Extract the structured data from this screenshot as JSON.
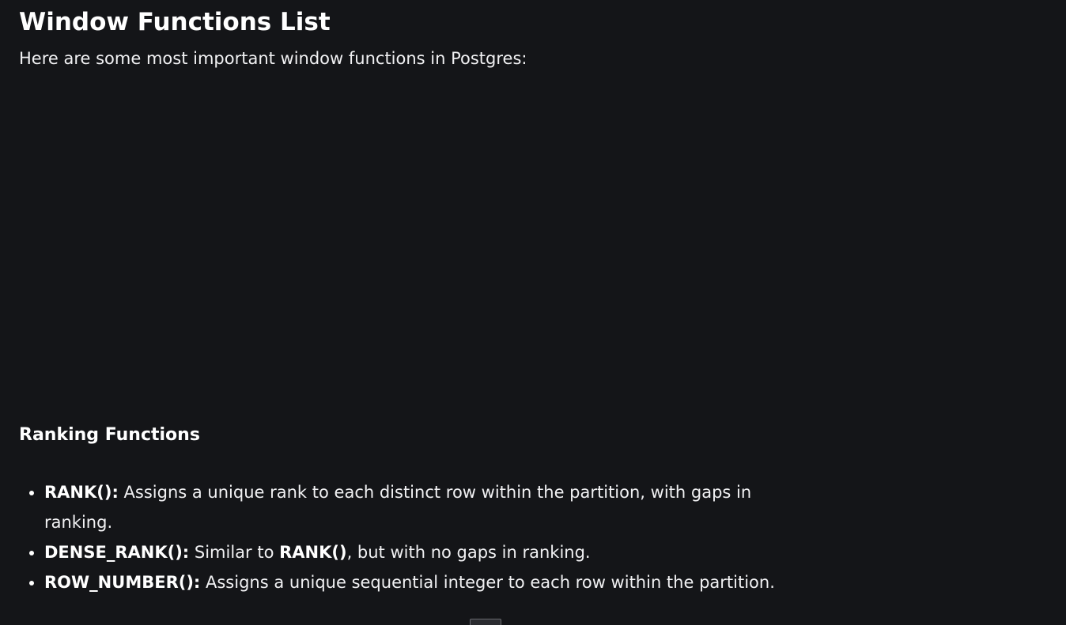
{
  "section": {
    "title": "Window Functions List",
    "intro": "Here are some most important window functions in Postgres:"
  },
  "ranking": {
    "heading": "Ranking Functions",
    "items": [
      {
        "name": "RANK():",
        "desc": " Assigns a unique rank to each distinct row within the partition, with gaps in ranking."
      },
      {
        "name": "DENSE_RANK():",
        "desc_before": " Similar to ",
        "ref": "RANK()",
        "desc_after": ", but with no gaps in ranking."
      },
      {
        "name": "ROW_NUMBER():",
        "desc": " Assigns a unique sequential integer to each row within the partition."
      }
    ]
  }
}
